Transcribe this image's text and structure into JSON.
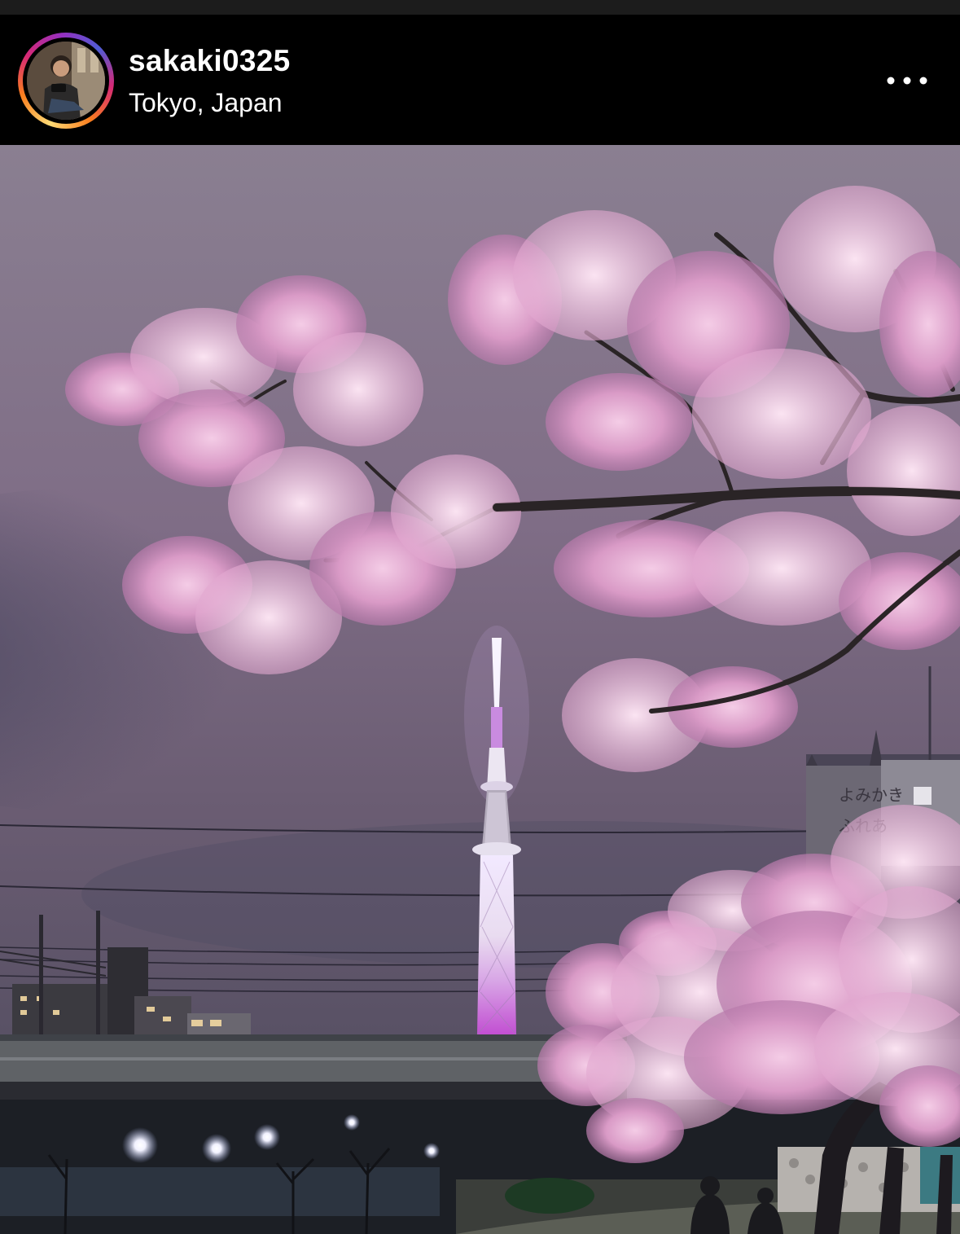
{
  "post": {
    "username": "sakaki0325",
    "location": "Tokyo, Japan",
    "more_icon": "more-horizontal-icon"
  },
  "photo": {
    "sign_text": "よみかき\nふれあ"
  },
  "colors": {
    "header_bg": "#000000",
    "username_text": "#ffffff",
    "story_ring_gradient": [
      "#feda75",
      "#fa7e1e",
      "#d62976",
      "#962fbf",
      "#4f5bd5"
    ]
  }
}
